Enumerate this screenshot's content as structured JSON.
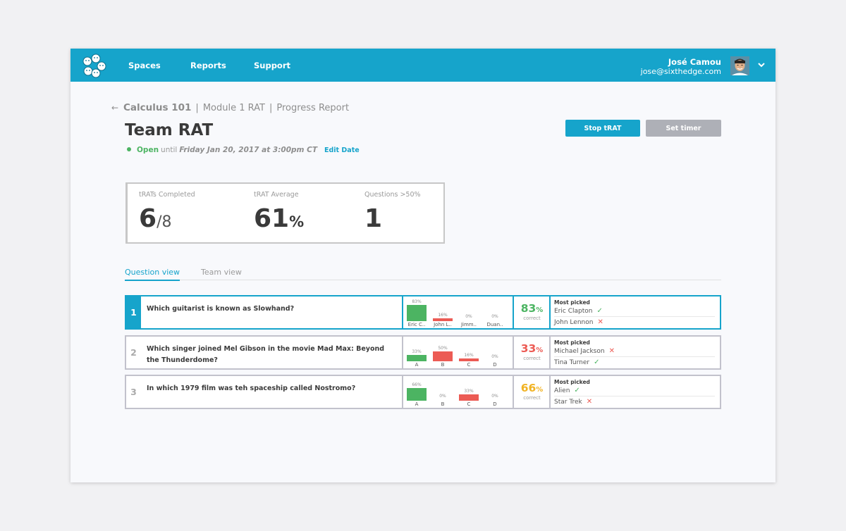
{
  "nav": {
    "links": [
      "Spaces",
      "Reports",
      "Support"
    ],
    "user_name": "José Camou",
    "user_email": "jose@sixthedge.com"
  },
  "breadcrumb": {
    "back_icon": "←",
    "course": "Calculus 101",
    "sep": "|",
    "module": "Module 1 RAT",
    "page": "Progress Report"
  },
  "title": "Team RAT",
  "status": {
    "state": "Open",
    "until": "until",
    "date": "Friday Jan 20, 2017 at 3:00pm CT",
    "edit": "Edit Date"
  },
  "actions": {
    "stop": "Stop tRAT",
    "timer": "Set timer"
  },
  "stats": {
    "completed_label": "tRATs Completed",
    "completed_value": "6",
    "completed_total": "/8",
    "average_label": "tRAT Average",
    "average_value": "61",
    "average_unit": "%",
    "questions_label": "Questions >50%",
    "questions_value": "1"
  },
  "tabs": [
    "Question view",
    "Team view"
  ],
  "questions": [
    {
      "num": "1",
      "text": "Which guitarist is known as Slowhand?",
      "bars": [
        {
          "pct": "83%",
          "value": 83,
          "label": "Eric C..",
          "color": "green"
        },
        {
          "pct": "16%",
          "value": 16,
          "label": "John L..",
          "color": "red"
        },
        {
          "pct": "0%",
          "value": 0,
          "label": "Jimm..",
          "color": "red"
        },
        {
          "pct": "0%",
          "value": 0,
          "label": "Duan..",
          "color": "red"
        }
      ],
      "correct": "83",
      "correct_color": "#4cb462",
      "picked": [
        {
          "name": "Eric Clapton",
          "ok": true
        },
        {
          "name": "John Lennon",
          "ok": false
        }
      ]
    },
    {
      "num": "2",
      "text": "Which singer joined Mel Gibson in the movie Mad Max: Beyond the Thunderdome?",
      "bars": [
        {
          "pct": "33%",
          "value": 33,
          "label": "A",
          "color": "green"
        },
        {
          "pct": "50%",
          "value": 50,
          "label": "B",
          "color": "red"
        },
        {
          "pct": "16%",
          "value": 16,
          "label": "C",
          "color": "red"
        },
        {
          "pct": "0%",
          "value": 0,
          "label": "D",
          "color": "red"
        }
      ],
      "correct": "33",
      "correct_color": "#ec5b54",
      "picked": [
        {
          "name": "Michael Jackson",
          "ok": false
        },
        {
          "name": "Tina Turner",
          "ok": true
        }
      ]
    },
    {
      "num": "3",
      "text": "In which 1979 film was teh spaceship called Nostromo?",
      "bars": [
        {
          "pct": "66%",
          "value": 66,
          "label": "A",
          "color": "green"
        },
        {
          "pct": "0%",
          "value": 0,
          "label": "B",
          "color": "red"
        },
        {
          "pct": "33%",
          "value": 33,
          "label": "C",
          "color": "red"
        },
        {
          "pct": "0%",
          "value": 0,
          "label": "D",
          "color": "red"
        }
      ],
      "correct": "66",
      "correct_color": "#f1b324",
      "picked": [
        {
          "name": "Alien",
          "ok": true
        },
        {
          "name": "Star Trek",
          "ok": false
        }
      ]
    }
  ],
  "labels": {
    "percent": "%",
    "correct": "correct",
    "most_picked": "Most picked",
    "check": "✓",
    "cross": "✕"
  }
}
